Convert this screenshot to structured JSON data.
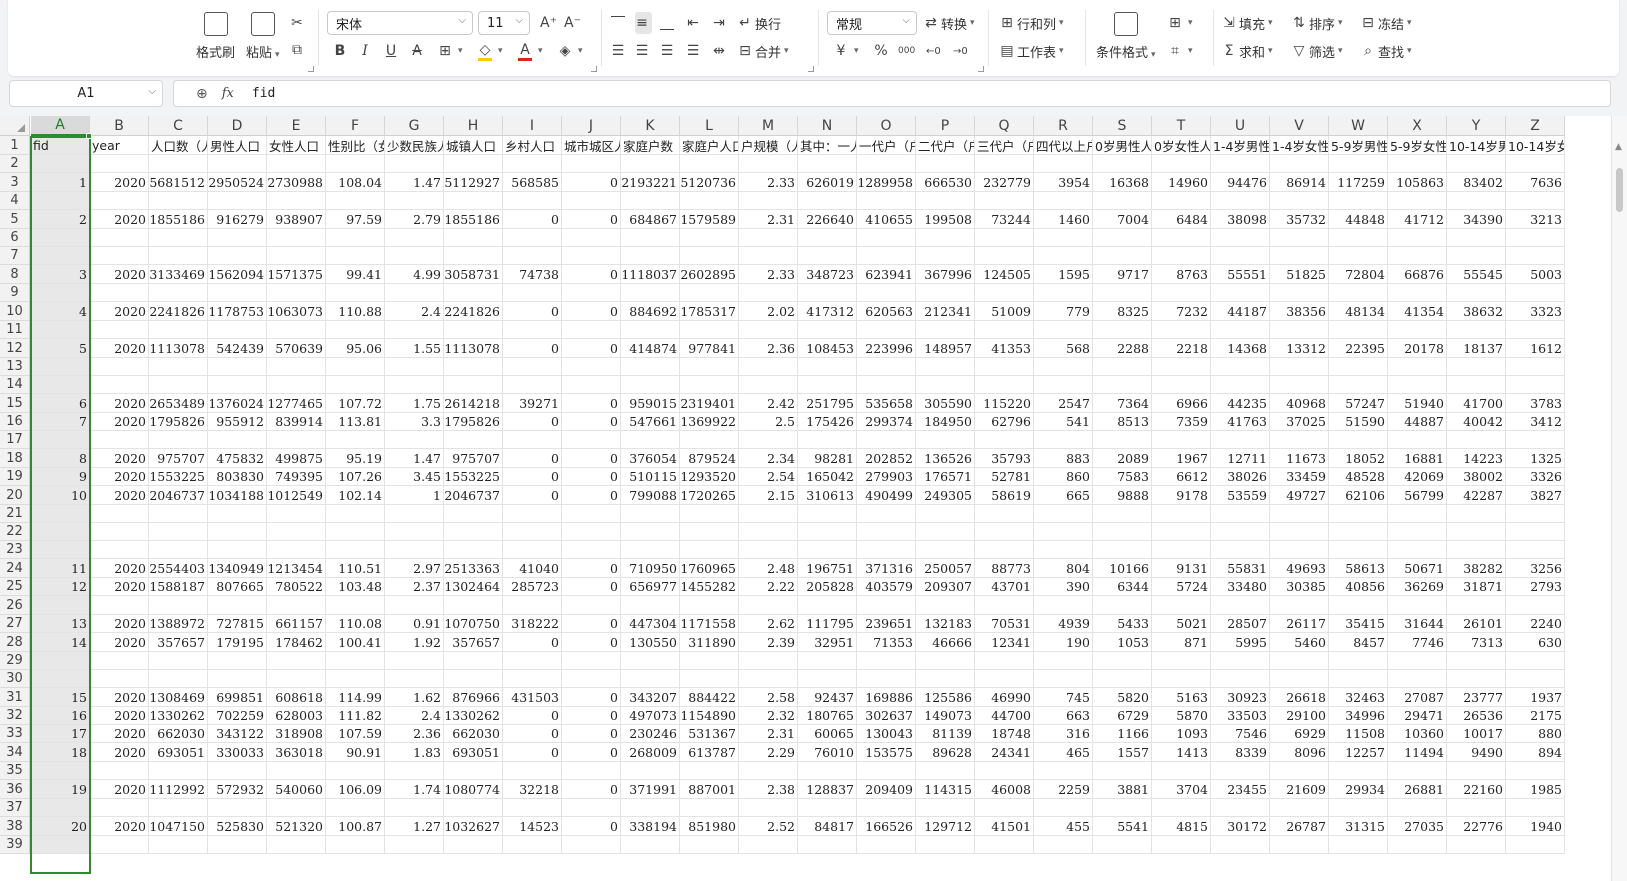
{
  "ribbon": {
    "format_painter": "格式刷",
    "paste": "粘贴",
    "font_name": "宋体",
    "font_size": "11",
    "wrap": "换行",
    "merge": "合并",
    "number_format": "常规",
    "convert": "转换",
    "rows_cols": "行和列",
    "worksheet": "工作表",
    "conditional_format": "条件格式",
    "fill": "填充",
    "sort": "排序",
    "freeze": "冻结",
    "sum": "求和",
    "filter": "筛选",
    "find": "查找",
    "currency_symbol": "¥",
    "percent_symbol": "%",
    "thousands_symbol": "000"
  },
  "formula_bar": {
    "name_box": "A1",
    "fx_label": "fx",
    "value": "fid"
  },
  "columns": [
    "A",
    "B",
    "C",
    "D",
    "E",
    "F",
    "G",
    "H",
    "I",
    "J",
    "K",
    "L",
    "M",
    "N",
    "O",
    "P",
    "Q",
    "R",
    "S",
    "T",
    "U",
    "V",
    "W",
    "X",
    "Y",
    "Z"
  ],
  "header_row": [
    "fid",
    "year",
    "人口数（人",
    "男性人口",
    "女性人口",
    "性别比（女",
    "少数民族人",
    "城镇人口",
    "乡村人口",
    "城市城区人",
    "家庭户数",
    "家庭户人口",
    "户规模（人",
    "其中：一人",
    "一代户（户",
    "二代户（户",
    "三代户（户",
    "四代以上户",
    "0岁男性人",
    "0岁女性人",
    "1-4岁男性",
    "1-4岁女性",
    "5-9岁男性",
    "5-9岁女性",
    "10-14岁男",
    "10-14岁女"
  ],
  "row_numbers": [
    "1",
    "2",
    "3",
    "4",
    "5",
    "6",
    "7",
    "8",
    "9",
    "10",
    "11",
    "12",
    "13",
    "14",
    "15",
    "16",
    "17",
    "18",
    "19",
    "20",
    "21",
    "22",
    "23",
    "24",
    "25",
    "26",
    "27",
    "28",
    "29",
    "30",
    "31",
    "32",
    "33",
    "34",
    "35",
    "36",
    "37",
    "38",
    "39"
  ],
  "records": [
    {
      "row": 3,
      "cells": [
        "1",
        "2020",
        "5681512",
        "2950524",
        "2730988",
        "108.04",
        "1.47",
        "5112927",
        "568585",
        "0",
        "2193221",
        "5120736",
        "2.33",
        "626019",
        "1289958",
        "666530",
        "232779",
        "3954",
        "16368",
        "14960",
        "94476",
        "86914",
        "117259",
        "105863",
        "83402",
        "7636"
      ]
    },
    {
      "row": 5,
      "cells": [
        "2",
        "2020",
        "1855186",
        "916279",
        "938907",
        "97.59",
        "2.79",
        "1855186",
        "0",
        "0",
        "684867",
        "1579589",
        "2.31",
        "226640",
        "410655",
        "199508",
        "73244",
        "1460",
        "7004",
        "6484",
        "38098",
        "35732",
        "44848",
        "41712",
        "34390",
        "3213"
      ]
    },
    {
      "row": 8,
      "cells": [
        "3",
        "2020",
        "3133469",
        "1562094",
        "1571375",
        "99.41",
        "4.99",
        "3058731",
        "74738",
        "0",
        "1118037",
        "2602895",
        "2.33",
        "348723",
        "623941",
        "367996",
        "124505",
        "1595",
        "9717",
        "8763",
        "55551",
        "51825",
        "72804",
        "66876",
        "55545",
        "5003"
      ]
    },
    {
      "row": 10,
      "cells": [
        "4",
        "2020",
        "2241826",
        "1178753",
        "1063073",
        "110.88",
        "2.4",
        "2241826",
        "0",
        "0",
        "884692",
        "1785317",
        "2.02",
        "417312",
        "620563",
        "212341",
        "51009",
        "779",
        "8325",
        "7232",
        "44187",
        "38356",
        "48134",
        "41354",
        "38632",
        "3323"
      ]
    },
    {
      "row": 12,
      "cells": [
        "5",
        "2020",
        "1113078",
        "542439",
        "570639",
        "95.06",
        "1.55",
        "1113078",
        "0",
        "0",
        "414874",
        "977841",
        "2.36",
        "108453",
        "223996",
        "148957",
        "41353",
        "568",
        "2288",
        "2218",
        "14368",
        "13312",
        "22395",
        "20178",
        "18137",
        "1612"
      ]
    },
    {
      "row": 15,
      "cells": [
        "6",
        "2020",
        "2653489",
        "1376024",
        "1277465",
        "107.72",
        "1.75",
        "2614218",
        "39271",
        "0",
        "959015",
        "2319401",
        "2.42",
        "251795",
        "535658",
        "305590",
        "115220",
        "2547",
        "7364",
        "6966",
        "44235",
        "40968",
        "57247",
        "51940",
        "41700",
        "3783"
      ]
    },
    {
      "row": 16,
      "cells": [
        "7",
        "2020",
        "1795826",
        "955912",
        "839914",
        "113.81",
        "3.3",
        "1795826",
        "0",
        "0",
        "547661",
        "1369922",
        "2.5",
        "175426",
        "299374",
        "184950",
        "62796",
        "541",
        "8513",
        "7359",
        "41763",
        "37025",
        "51590",
        "44887",
        "40042",
        "3412"
      ]
    },
    {
      "row": 18,
      "cells": [
        "8",
        "2020",
        "975707",
        "475832",
        "499875",
        "95.19",
        "1.47",
        "975707",
        "0",
        "0",
        "376054",
        "879524",
        "2.34",
        "98281",
        "202852",
        "136526",
        "35793",
        "883",
        "2089",
        "1967",
        "12711",
        "11673",
        "18052",
        "16881",
        "14223",
        "1325"
      ]
    },
    {
      "row": 19,
      "cells": [
        "9",
        "2020",
        "1553225",
        "803830",
        "749395",
        "107.26",
        "3.45",
        "1553225",
        "0",
        "0",
        "510115",
        "1293520",
        "2.54",
        "165042",
        "279903",
        "176571",
        "52781",
        "860",
        "7583",
        "6612",
        "38026",
        "33459",
        "48528",
        "42069",
        "38002",
        "3326"
      ]
    },
    {
      "row": 20,
      "cells": [
        "10",
        "2020",
        "2046737",
        "1034188",
        "1012549",
        "102.14",
        "1",
        "2046737",
        "0",
        "0",
        "799088",
        "1720265",
        "2.15",
        "310613",
        "490499",
        "249305",
        "58619",
        "665",
        "9888",
        "9178",
        "53559",
        "49727",
        "62106",
        "56799",
        "42287",
        "3827"
      ]
    },
    {
      "row": 24,
      "cells": [
        "11",
        "2020",
        "2554403",
        "1340949",
        "1213454",
        "110.51",
        "2.97",
        "2513363",
        "41040",
        "0",
        "710950",
        "1760965",
        "2.48",
        "196751",
        "371316",
        "250057",
        "88773",
        "804",
        "10166",
        "9131",
        "55831",
        "49693",
        "58613",
        "50671",
        "38282",
        "3256"
      ]
    },
    {
      "row": 25,
      "cells": [
        "12",
        "2020",
        "1588187",
        "807665",
        "780522",
        "103.48",
        "2.37",
        "1302464",
        "285723",
        "0",
        "656977",
        "1455282",
        "2.22",
        "205828",
        "403579",
        "209307",
        "43701",
        "390",
        "6344",
        "5724",
        "33480",
        "30385",
        "40856",
        "36269",
        "31871",
        "2793"
      ]
    },
    {
      "row": 27,
      "cells": [
        "13",
        "2020",
        "1388972",
        "727815",
        "661157",
        "110.08",
        "0.91",
        "1070750",
        "318222",
        "0",
        "447304",
        "1171558",
        "2.62",
        "111795",
        "239651",
        "132183",
        "70531",
        "4939",
        "5433",
        "5021",
        "28507",
        "26117",
        "35415",
        "31644",
        "26101",
        "2240"
      ]
    },
    {
      "row": 28,
      "cells": [
        "14",
        "2020",
        "357657",
        "179195",
        "178462",
        "100.41",
        "1.92",
        "357657",
        "0",
        "0",
        "130550",
        "311890",
        "2.39",
        "32951",
        "71353",
        "46666",
        "12341",
        "190",
        "1053",
        "871",
        "5995",
        "5460",
        "8457",
        "7746",
        "7313",
        "630"
      ]
    },
    {
      "row": 31,
      "cells": [
        "15",
        "2020",
        "1308469",
        "699851",
        "608618",
        "114.99",
        "1.62",
        "876966",
        "431503",
        "0",
        "343207",
        "884422",
        "2.58",
        "92437",
        "169886",
        "125586",
        "46990",
        "745",
        "5820",
        "5163",
        "30923",
        "26618",
        "32463",
        "27087",
        "23777",
        "1937"
      ]
    },
    {
      "row": 32,
      "cells": [
        "16",
        "2020",
        "1330262",
        "702259",
        "628003",
        "111.82",
        "2.4",
        "1330262",
        "0",
        "0",
        "497073",
        "1154890",
        "2.32",
        "180765",
        "302637",
        "149073",
        "44700",
        "663",
        "6729",
        "5870",
        "33503",
        "29100",
        "34996",
        "29471",
        "26536",
        "2175"
      ]
    },
    {
      "row": 33,
      "cells": [
        "17",
        "2020",
        "662030",
        "343122",
        "318908",
        "107.59",
        "2.36",
        "662030",
        "0",
        "0",
        "230246",
        "531367",
        "2.31",
        "60065",
        "130043",
        "81139",
        "18748",
        "316",
        "1166",
        "1093",
        "7546",
        "6929",
        "11508",
        "10360",
        "10017",
        "880"
      ]
    },
    {
      "row": 34,
      "cells": [
        "18",
        "2020",
        "693051",
        "330033",
        "363018",
        "90.91",
        "1.83",
        "693051",
        "0",
        "0",
        "268009",
        "613787",
        "2.29",
        "76010",
        "153575",
        "89628",
        "24341",
        "465",
        "1557",
        "1413",
        "8339",
        "8096",
        "12257",
        "11494",
        "9490",
        "894"
      ]
    },
    {
      "row": 36,
      "cells": [
        "19",
        "2020",
        "1112992",
        "572932",
        "540060",
        "106.09",
        "1.74",
        "1080774",
        "32218",
        "0",
        "371991",
        "887001",
        "2.38",
        "128837",
        "209409",
        "114315",
        "46008",
        "2259",
        "3881",
        "3704",
        "23455",
        "21609",
        "29934",
        "26881",
        "22160",
        "1985"
      ]
    },
    {
      "row": 38,
      "cells": [
        "20",
        "2020",
        "1047150",
        "525830",
        "521320",
        "100.87",
        "1.27",
        "1032627",
        "14523",
        "0",
        "338194",
        "851980",
        "2.52",
        "84817",
        "166526",
        "129712",
        "41501",
        "455",
        "5541",
        "4815",
        "30172",
        "26787",
        "31315",
        "27035",
        "22776",
        "1940"
      ]
    }
  ]
}
